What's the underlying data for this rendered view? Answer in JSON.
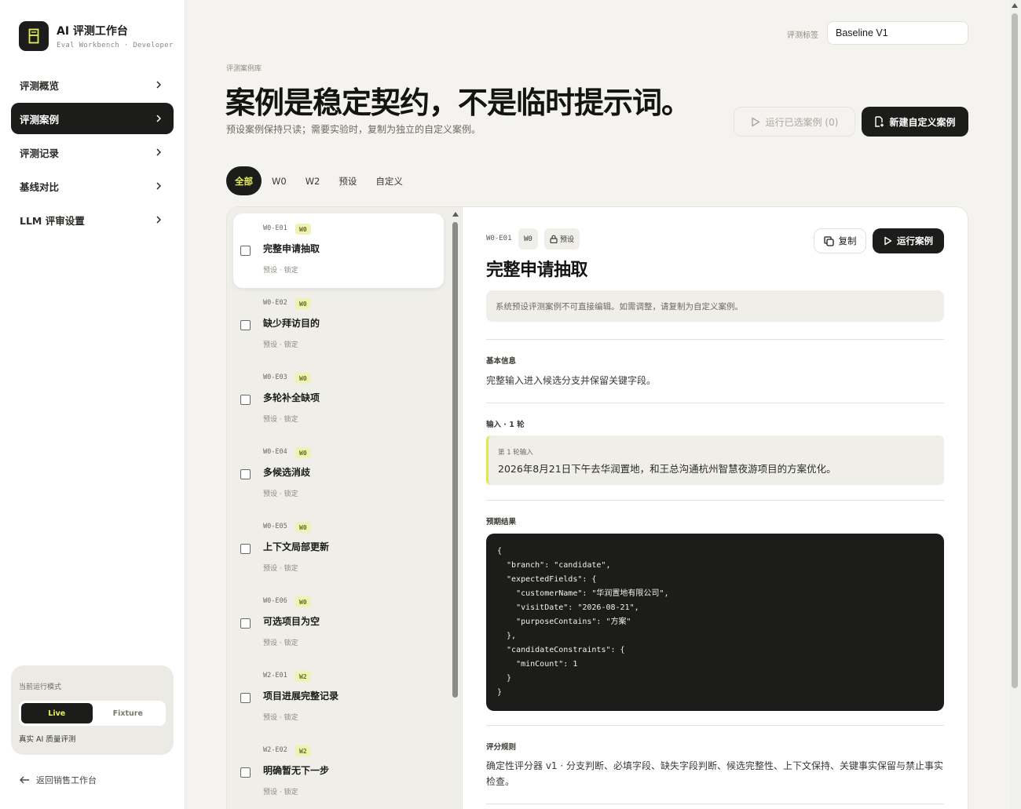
{
  "brand": {
    "title": "AI 评测工作台",
    "subtitle": "Eval Workbench · Developer"
  },
  "nav": {
    "items": [
      {
        "label": "评测概览",
        "active": false
      },
      {
        "label": "评测案例",
        "active": true
      },
      {
        "label": "评测记录",
        "active": false
      },
      {
        "label": "基线对比",
        "active": false
      },
      {
        "label": "LLM 评审设置",
        "active": false
      }
    ]
  },
  "mode": {
    "label": "当前运行模式",
    "options": [
      "Live",
      "Fixture"
    ],
    "selected": "Live",
    "description": "真实 AI 质量评测"
  },
  "back_link": "返回销售工作台",
  "eval_tag": {
    "label": "评测标签",
    "value": "Baseline V1"
  },
  "header": {
    "eyebrow": "评测案例库",
    "title": "案例是稳定契约，不是临时提示词。",
    "subtitle": "预设案例保持只读；需要实验时，复制为独立的自定义案例。",
    "run_selected": "运行已选案例 (0)",
    "new_case": "新建自定义案例"
  },
  "filters": {
    "tabs": [
      "全部",
      "W0",
      "W2",
      "预设",
      "自定义"
    ],
    "selected": "全部"
  },
  "cases": [
    {
      "id": "W0-E01",
      "badge": "W0",
      "title": "完整申请抽取",
      "meta": "预设 · 锁定"
    },
    {
      "id": "W0-E02",
      "badge": "W0",
      "title": "缺少拜访目的",
      "meta": "预设 · 锁定"
    },
    {
      "id": "W0-E03",
      "badge": "W0",
      "title": "多轮补全缺项",
      "meta": "预设 · 锁定"
    },
    {
      "id": "W0-E04",
      "badge": "W0",
      "title": "多候选消歧",
      "meta": "预设 · 锁定"
    },
    {
      "id": "W0-E05",
      "badge": "W0",
      "title": "上下文局部更新",
      "meta": "预设 · 锁定"
    },
    {
      "id": "W0-E06",
      "badge": "W0",
      "title": "可选项目为空",
      "meta": "预设 · 锁定"
    },
    {
      "id": "W2-E01",
      "badge": "W2",
      "title": "项目进展完整记录",
      "meta": "预设 · 锁定"
    },
    {
      "id": "W2-E02",
      "badge": "W2",
      "title": "明确暂无下一步",
      "meta": "预设 · 锁定"
    }
  ],
  "detail": {
    "id": "W0-E01",
    "badge": "W0",
    "lock_badge": "预设",
    "title": "完整申请抽取",
    "copy_label": "复制",
    "run_label": "运行案例",
    "notice": "系统预设评测案例不可直接编辑。如需调整，请复制为自定义案例。",
    "basic_label": "基本信息",
    "basic_text": "完整输入进入候选分支并保留关键字段。",
    "input_label": "输入 · 1 轮",
    "round_label": "第 1 轮输入",
    "round_text": "2026年8月21日下午去华润置地，和王总沟通杭州智慧夜游项目的方案优化。",
    "expected_label": "预期结果",
    "expected_json": "{\n  \"branch\": \"candidate\",\n  \"expectedFields\": {\n    \"customerName\": \"华润置地有限公司\",\n    \"visitDate\": \"2026-08-21\",\n    \"purposeContains\": \"方案\"\n  },\n  \"candidateConstraints\": {\n    \"minCount\": 1\n  }\n}",
    "scoring_label": "评分规则",
    "scoring_text": "确定性评分器 v1 · 分支判断、必填字段、缺失字段判断、候选完整性、上下文保持、关键事实保留与禁止事实检查。"
  }
}
